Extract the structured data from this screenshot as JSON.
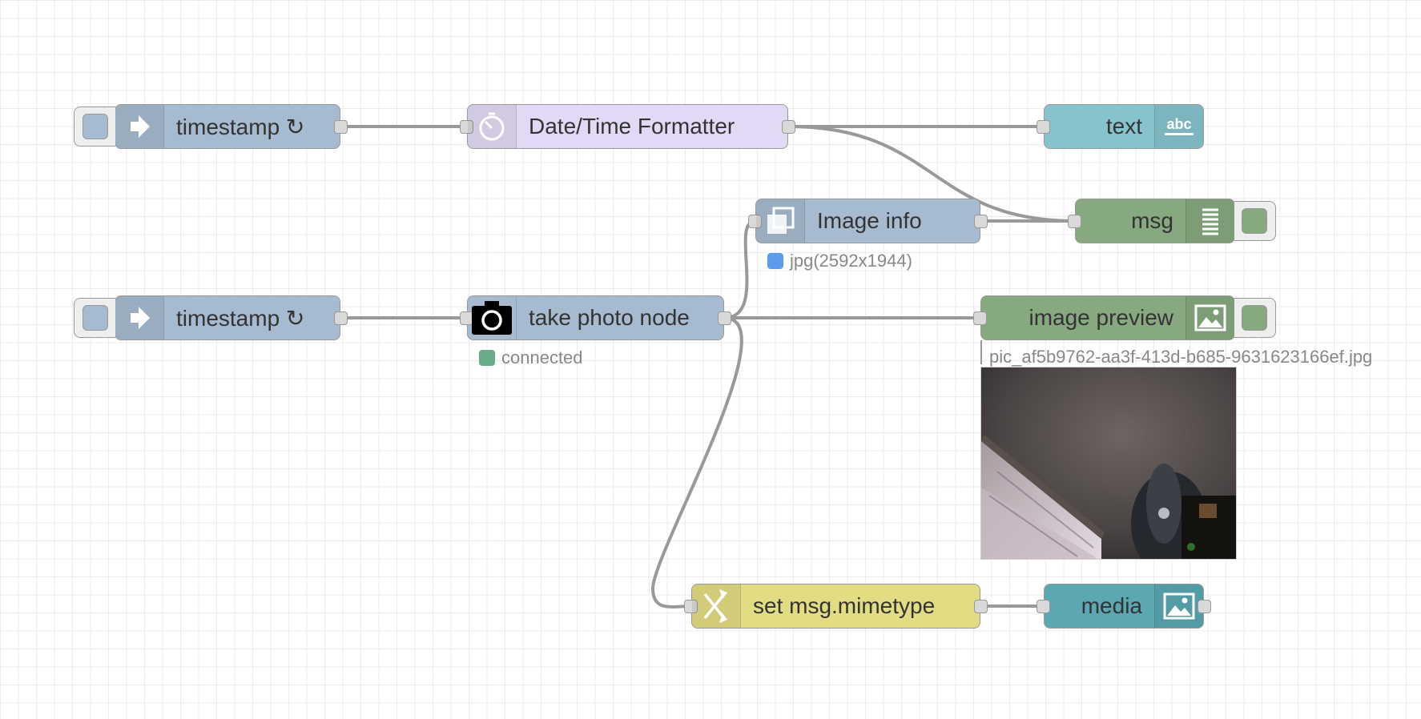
{
  "nodes": {
    "inject1": {
      "label": "timestamp ↻",
      "color": "#a6bbcf",
      "icon": "arrow-in-icon"
    },
    "datetime": {
      "label": "Date/Time Formatter",
      "color": "#e2d9f4",
      "icon": "timer-icon"
    },
    "text": {
      "label": "text",
      "color": "#87c3cd",
      "icon": "abc-icon"
    },
    "imageinfo": {
      "label": "Image info",
      "color": "#a6bbcf",
      "icon": "copy-icon",
      "status": "jpg(2592x1944)",
      "status_color": "#5b9cec"
    },
    "msg": {
      "label": "msg",
      "color": "#87a980",
      "icon": "list-icon"
    },
    "inject2": {
      "label": "timestamp ↻",
      "color": "#a6bbcf",
      "icon": "arrow-in-icon"
    },
    "camera": {
      "label": "take photo node",
      "color": "#a6bbcf",
      "icon": "camera-icon",
      "status": "connected",
      "status_color": "#6aab89"
    },
    "imagepreview": {
      "label": "image preview",
      "color": "#87a980",
      "icon": "image-icon",
      "caption": "pic_af5b9762-aa3f-413d-b685-9631623166ef.jpg"
    },
    "change": {
      "label": "set msg.mimetype",
      "color": "#e2dc83",
      "icon": "shuffle-icon"
    },
    "media": {
      "label": "media",
      "color": "#5ba8b2",
      "icon": "image-icon"
    }
  },
  "colors": {
    "wire": "#999999",
    "grid": "#ececec"
  }
}
